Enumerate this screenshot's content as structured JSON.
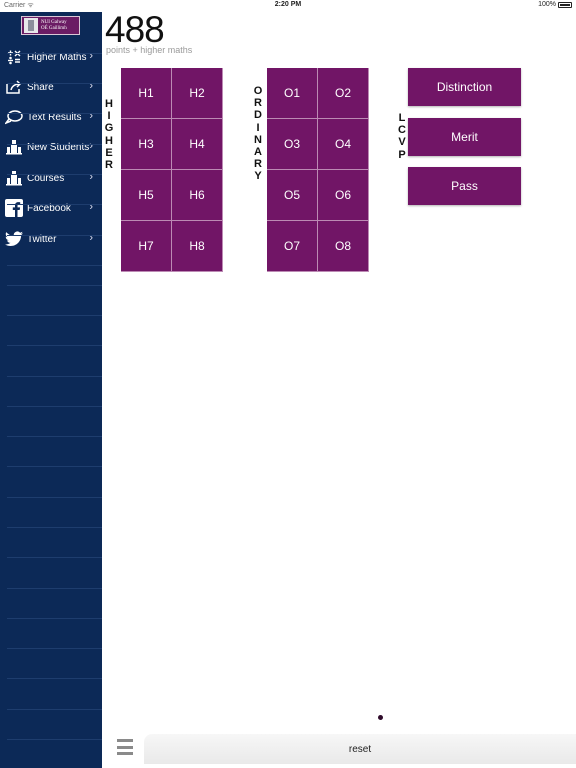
{
  "status_bar": {
    "carrier": "Carrier ᯤ",
    "time": "2:20 PM",
    "battery": "100%"
  },
  "sidebar": {
    "logo_line1": "NUI Galway",
    "logo_line2": "OÉ Gaillimh",
    "items": [
      {
        "label": "Higher Maths",
        "icon": "math-icon"
      },
      {
        "label": "Share",
        "icon": "share-icon"
      },
      {
        "label": "Text Results",
        "icon": "chat-icon"
      },
      {
        "label": "New Students",
        "icon": "building-icon"
      },
      {
        "label": "Courses",
        "icon": "building-icon"
      },
      {
        "label": "Facebook",
        "icon": "facebook-icon"
      },
      {
        "label": "Twitter",
        "icon": "twitter-icon"
      }
    ],
    "chevron": "›"
  },
  "main": {
    "points": "488",
    "points_label": "points + higher maths",
    "higher_label": [
      "H",
      "I",
      "G",
      "H",
      "E",
      "R"
    ],
    "ordinary_label": [
      "O",
      "R",
      "D",
      "I",
      "N",
      "A",
      "R",
      "Y"
    ],
    "lcvp_label": [
      "L",
      "C",
      "V",
      "P"
    ],
    "higher_grades": [
      "H1",
      "H2",
      "H3",
      "H4",
      "H5",
      "H6",
      "H7",
      "H8"
    ],
    "ordinary_grades": [
      "O1",
      "O2",
      "O3",
      "O4",
      "O5",
      "O6",
      "O7",
      "O8"
    ],
    "lcvp_grades": [
      "Distinction",
      "Merit",
      "Pass"
    ]
  },
  "bottom": {
    "reset_label": "reset"
  },
  "colors": {
    "sidebar": "#0c2957",
    "button": "#711566"
  }
}
